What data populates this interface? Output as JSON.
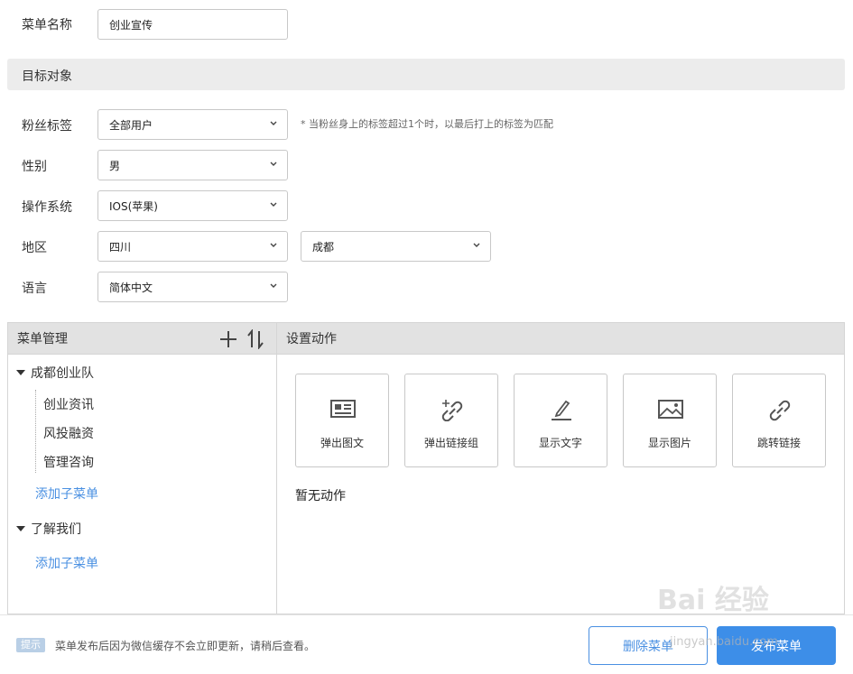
{
  "form": {
    "menu_name_label": "菜单名称",
    "menu_name_value": "创业宣传",
    "target_section_title": "目标对象",
    "fans_tag_label": "粉丝标签",
    "fans_tag_value": "全部用户",
    "fans_tag_hint": "* 当粉丝身上的标签超过1个时，以最后打上的标签为匹配",
    "gender_label": "性别",
    "gender_value": "男",
    "os_label": "操作系统",
    "os_value": "IOS(苹果)",
    "region_label": "地区",
    "province_value": "四川",
    "city_value": "成都",
    "language_label": "语言",
    "language_value": "简体中文"
  },
  "menu_panel": {
    "title": "菜单管理",
    "add_icon": "plus-icon",
    "sort_icon": "sort-arrows-icon",
    "tree": [
      {
        "label": "成都创业队",
        "children": [
          "创业资讯",
          "风投融资",
          "管理咨询"
        ],
        "add_sub_label": "添加子菜单"
      },
      {
        "label": "了解我们",
        "children": [],
        "add_sub_label": "添加子菜单"
      }
    ]
  },
  "action_panel": {
    "title": "设置动作",
    "actions": [
      {
        "label": "弹出图文",
        "icon": "news-card-icon"
      },
      {
        "label": "弹出链接组",
        "icon": "link-add-icon"
      },
      {
        "label": "显示文字",
        "icon": "pencil-icon"
      },
      {
        "label": "显示图片",
        "icon": "image-icon"
      },
      {
        "label": "跳转链接",
        "icon": "link-icon"
      }
    ],
    "empty_text": "暂无动作"
  },
  "footer": {
    "tip_badge": "提示",
    "tip_text": "菜单发布后因为微信缓存不会立即更新，请稍后查看。",
    "delete_label": "删除菜单",
    "publish_label": "发布菜单"
  },
  "watermark": {
    "text": "Bai 经验",
    "sub": "jingyan.baidu.com"
  },
  "colors": {
    "accent": "#4a90e2",
    "primary_button": "#3d8ee8",
    "header_bg": "#e2e2e2"
  }
}
